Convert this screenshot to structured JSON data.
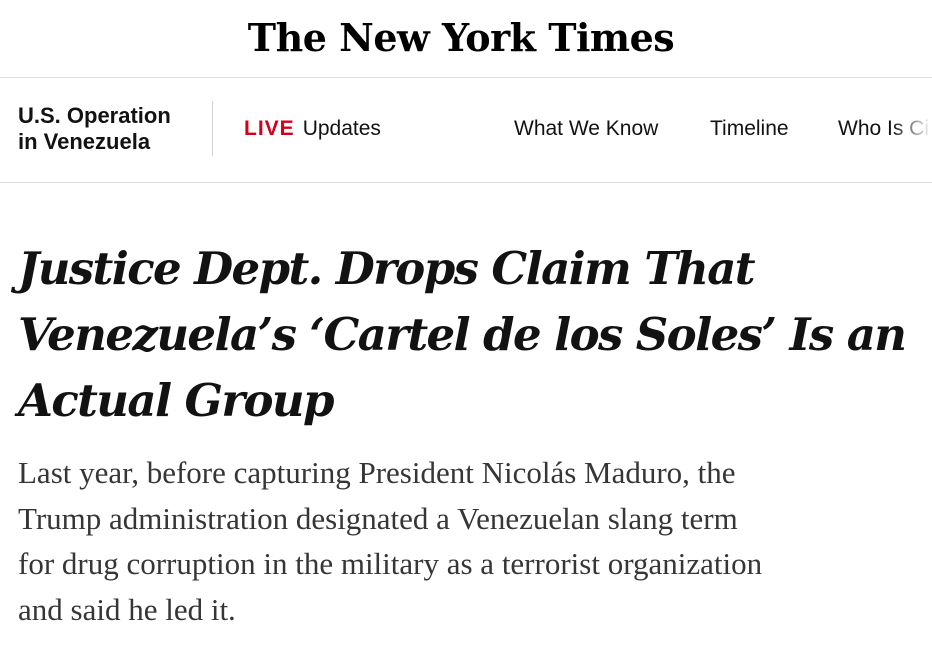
{
  "masthead": {
    "logo_text": "The New York Times"
  },
  "story_nav": {
    "section_line1": "U.S. Operation",
    "section_line2": "in Venezuela",
    "live_badge": "LIVE",
    "live_label": "Updates",
    "links": [
      {
        "label": "What We Know"
      },
      {
        "label": "Timeline"
      },
      {
        "label": "Who Is Ci"
      }
    ]
  },
  "article": {
    "headline_line1": "Justice Dept. Drops Claim That",
    "headline_line2": "Venezuela’s ‘Cartel de los Soles’ Is an",
    "headline_line3": "Actual Group",
    "summary_line1": "Last year, before capturing President Nicolás Maduro, the",
    "summary_line2": "Trump administration designated a Venezuelan slang term",
    "summary_line3": "for drug corruption in the military as a terrorist organization",
    "summary_line4": "and said he led it."
  },
  "colors": {
    "live_red": "#d0021b",
    "text_dark": "#121212",
    "summary_gray": "#363636",
    "divider": "#dfdfdf"
  }
}
